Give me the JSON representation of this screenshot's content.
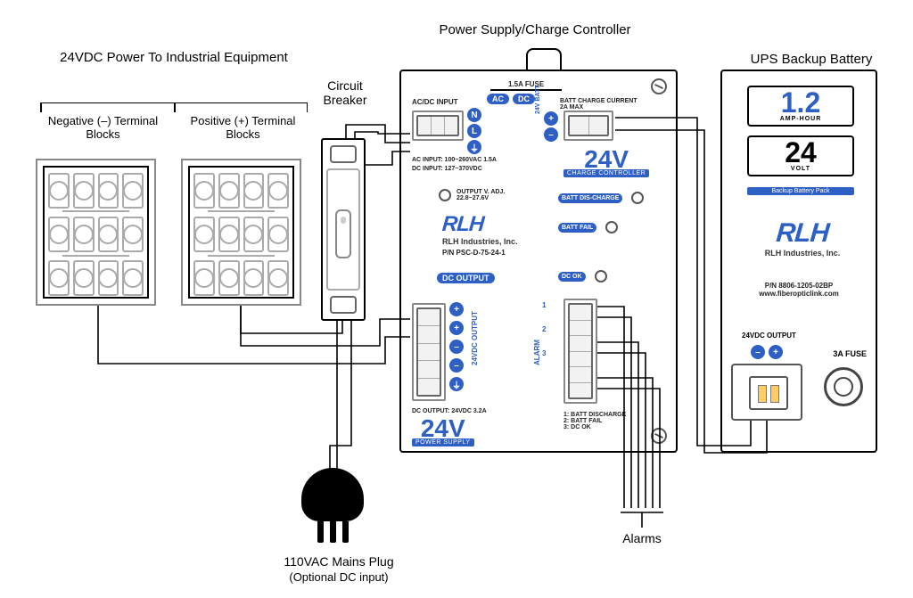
{
  "titles": {
    "psu": "Power Supply/Charge Controller",
    "ups": "UPS Backup Battery",
    "terminals": "24VDC Power To Industrial Equipment",
    "breaker": "Circuit Breaker",
    "mains": "110VAC Mains Plug",
    "mains_sub": "(Optional DC input)",
    "alarms": "Alarms"
  },
  "terminals": {
    "neg": "Negative (–) Terminal Blocks",
    "pos": "Positive (+) Terminal Blocks"
  },
  "psu": {
    "fuse": "1.5A FUSE",
    "acdc_input": "AC/DC INPUT",
    "ac": "AC",
    "dc": "DC",
    "nli": [
      "N",
      "L",
      "⏚"
    ],
    "ac_input_spec": "AC INPUT: 100~260VAC  1.5A",
    "dc_input_spec": "DC INPUT: 127~370VDC",
    "output_adj": "OUTPUT V. ADJ. 22.8~27.6V",
    "batt_charge": "BATT CHARGE CURRENT 2A MAX",
    "batt_label": "24V BATT",
    "batt_signs": [
      "+",
      "–"
    ],
    "charge_ctrl": "CHARGE CONTROLLER",
    "brand": "RLH",
    "brand_sub": "RLH Industries, Inc.",
    "pn": "P/N  PSC-D-75-24-1",
    "dc_output_pill": "DC OUTPUT",
    "dc_out_terms": [
      "+",
      "+",
      "–",
      "–",
      "⏚"
    ],
    "dc_out_label": "24VDC OUTPUT",
    "alarm_label": "ALARM",
    "alarm_nums": [
      "1",
      "2",
      "3"
    ],
    "alarm_legend_title": "1: BATT DISCHARGE",
    "alarm_legend_2": "2: BATT FAIL",
    "alarm_legend_3": "3: DC OK",
    "status": {
      "batt_discharge": "BATT DIS-CHARGE",
      "batt_fail": "BATT FAIL",
      "dc_ok": "DC OK"
    },
    "dc_output_spec": "DC OUTPUT: 24VDC  3.2A",
    "big": "24V",
    "ps_pill": "POWER SUPPLY"
  },
  "ups": {
    "amp_val": "1.2",
    "amp_unit": "AMP-HOUR",
    "volt_val": "24",
    "volt_unit": "VOLT",
    "pack": "Backup Battery Pack",
    "brand": "RLH",
    "brand_sub": "RLH Industries, Inc.",
    "pn": "P/N 8806-1205-02BP",
    "url": "www.fiberopticlink.com",
    "out_label": "24VDC OUTPUT",
    "out_signs": [
      "–",
      "+"
    ],
    "fuse": "3A FUSE"
  }
}
